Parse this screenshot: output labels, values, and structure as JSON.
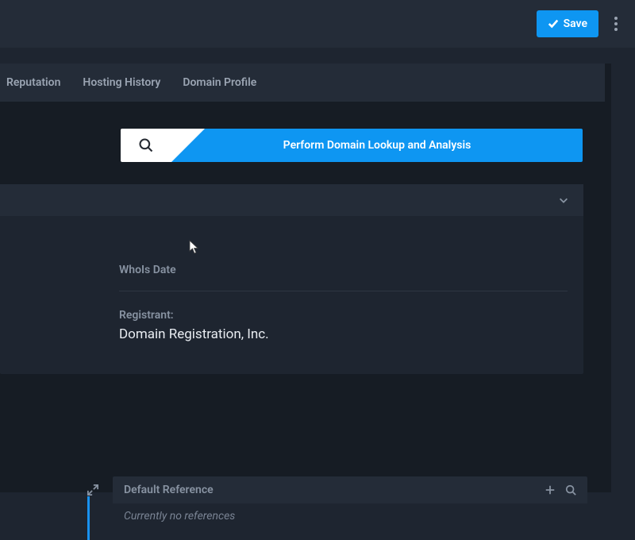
{
  "topbar": {
    "save_label": "Save"
  },
  "tabs": [
    {
      "label": "Reputation"
    },
    {
      "label": "Hosting History"
    },
    {
      "label": "Domain Profile"
    }
  ],
  "lookup": {
    "label": "Perform Domain Lookup and Analysis"
  },
  "whois": {
    "date_label": "WhoIs Date",
    "registrant_label": "Registrant:",
    "registrant_value": "Domain Registration, Inc."
  },
  "references": {
    "title": "Default Reference",
    "empty_text": "Currently no references"
  }
}
